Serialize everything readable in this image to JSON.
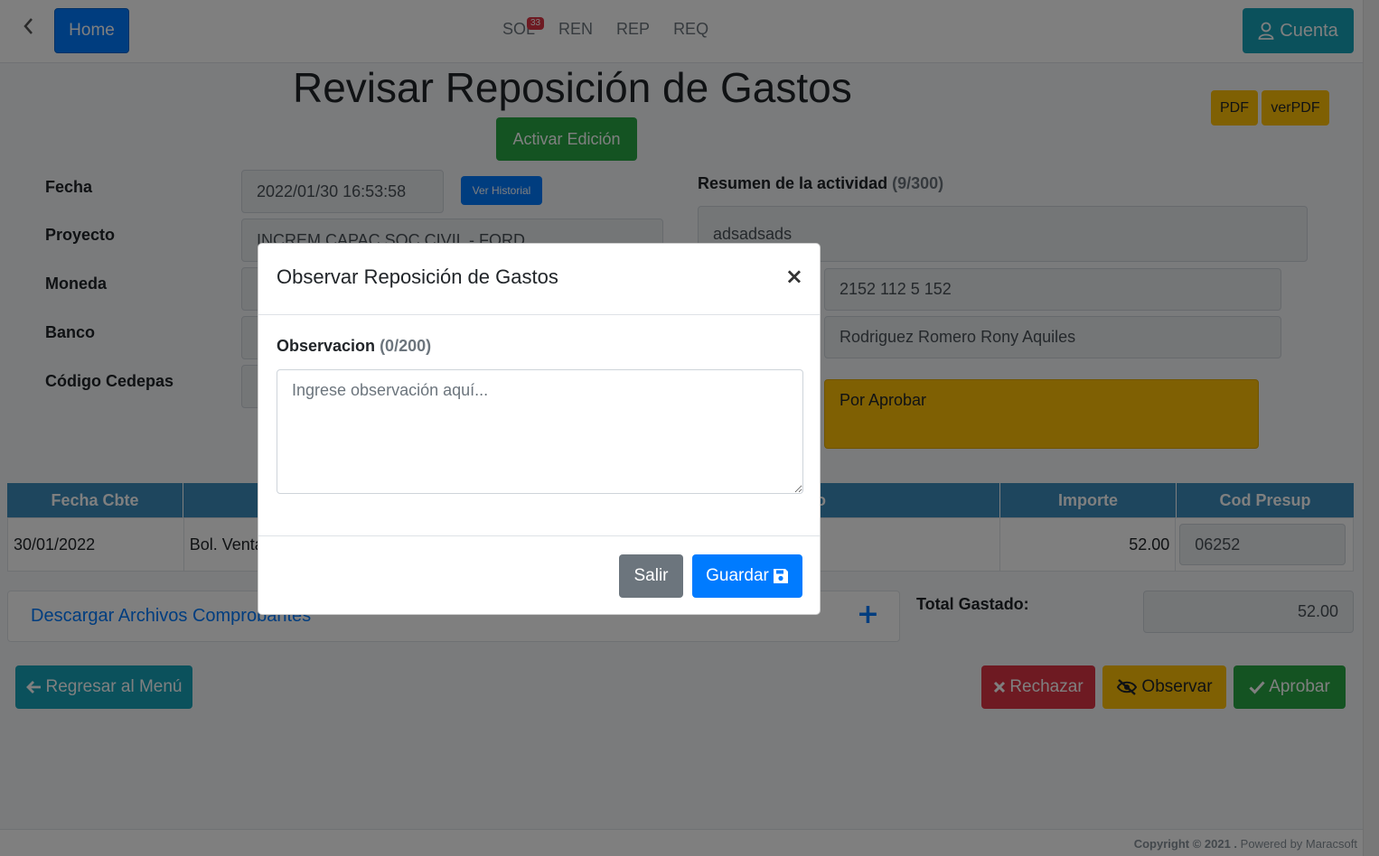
{
  "nav": {
    "home_label": "Home",
    "links": [
      {
        "label": "SOL",
        "badge": "33"
      },
      {
        "label": "REN"
      },
      {
        "label": "REP"
      },
      {
        "label": "REQ"
      }
    ],
    "account_label": "Cuenta"
  },
  "page": {
    "title": "Revisar Reposición de Gastos",
    "activate_edit_label": "Activar Edición",
    "pdf_label": "PDF",
    "verpdf_label": "verPDF"
  },
  "form": {
    "fecha_label": "Fecha",
    "fecha_value": "2022/01/30 16:53:58",
    "ver_historial_label": "Ver Historial",
    "proyecto_label": "Proyecto",
    "proyecto_value": "INCREM.CAPAC.SOC.CIVIL - FORD",
    "moneda_label": "Moneda",
    "banco_label": "Banco",
    "codigo_label": "Código Cedepas",
    "resumen_label": "Resumen de la actividad",
    "resumen_counter": "(9/300)",
    "resumen_value": "adsadsads",
    "cuenta_value": "2152 112 5 152",
    "persona_value": "Rodriguez Romero Rony Aquiles",
    "estado_value": "Por Aprobar"
  },
  "table": {
    "headers": [
      "Fecha Cbte",
      "",
      "o",
      "Importe",
      "Cod Presup"
    ],
    "rows": [
      {
        "fecha": "30/01/2022",
        "tipo": "Bol. Venta",
        "importe": "52.00",
        "cod": "06252"
      }
    ]
  },
  "downloads": {
    "label": "Descargar Archivos Comprobantes"
  },
  "totals": {
    "label": "Total Gastado:",
    "value": "52.00"
  },
  "actions": {
    "back_label": "Regresar al Menú",
    "reject_label": "Rechazar",
    "observe_label": "Observar",
    "approve_label": "Aprobar"
  },
  "footer": {
    "copyright": "Copyright © 2021 .",
    "powered": "Powered by Maracsoft"
  },
  "modal": {
    "title": "Observar Reposición de Gastos",
    "field_label": "Observacion",
    "field_counter": "(0/200)",
    "placeholder": "Ingrese observación aquí...",
    "cancel_label": "Salir",
    "save_label": "Guardar"
  },
  "colors": {
    "primary": "#007bff",
    "info": "#17a2b8",
    "success": "#28a745",
    "warning": "#ffc107",
    "danger": "#dc3545",
    "table_header": "#3c8dbc"
  },
  "icons": [
    "chevron-left-icon",
    "user-icon",
    "arrow-left-icon",
    "times-icon",
    "eye-slash-icon",
    "check-icon",
    "save-icon",
    "plus-icon",
    "close-icon"
  ]
}
